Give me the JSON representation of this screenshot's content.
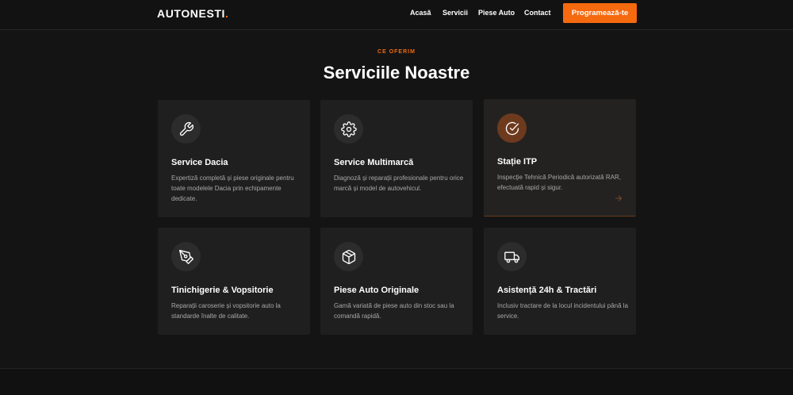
{
  "brand": {
    "name": "AUTONESTI",
    "dot": ".",
    "accent_color": "#f26a12"
  },
  "nav": {
    "links": [
      {
        "label": "Acasă"
      },
      {
        "label": "Servicii"
      },
      {
        "label": "Piese Auto"
      },
      {
        "label": "Contact"
      }
    ],
    "cta_label": "Programează-te"
  },
  "services": {
    "eyebrow": "CE OFERIM",
    "title": "Serviciile Noastre",
    "cards": [
      {
        "icon": "wrench-icon",
        "title": "Service Dacia",
        "description": "Expertiză completă și piese originale pentru toate modelele Dacia prin echipamente dedicate."
      },
      {
        "icon": "gear-icon",
        "title": "Service Multimarcă",
        "description": "Diagnoză și reparații profesionale pentru orice marcă și model de autovehicul."
      },
      {
        "icon": "check-circle-icon",
        "title": "Stație ITP",
        "description": "Inspecție Tehnică Periodică autorizată RAR, efectuată rapid și sigur.",
        "highlighted": true
      },
      {
        "icon": "pen-nib-icon",
        "title": "Tinichigerie & Vopsitorie",
        "description": "Reparații caroserie și vopsitorie auto la standarde înalte de calitate."
      },
      {
        "icon": "box-icon",
        "title": "Piese Auto Originale",
        "description": "Gamă variată de piese auto din stoc sau la comandă rapidă."
      },
      {
        "icon": "truck-icon",
        "title": "Asistență 24h & Tractări",
        "description": "Inclusiv tractare de la locul incidentului până la service."
      }
    ]
  }
}
